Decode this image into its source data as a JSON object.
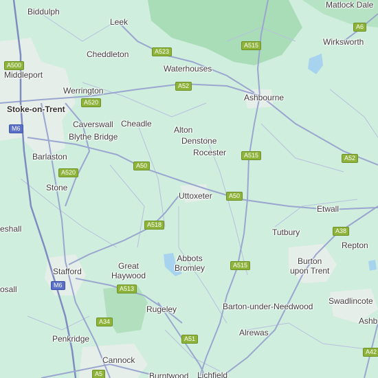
{
  "colors": {
    "land": "#cfeedd",
    "park": "#a9ddb8",
    "urban": "#e6eee9",
    "water": "#a8d3ef",
    "road": "#9aa6cf",
    "major_road_casing": "#7f8cc0",
    "a_road_shield": "#8db33a",
    "motorway_shield": "#5a6fc6"
  },
  "places": {
    "biddulph": "Biddulph",
    "leek": "Leek",
    "matlock_dale": "Matlock Dale",
    "wirksworth": "Wirksworth",
    "cheddleton": "Cheddleton",
    "waterhouses": "Waterhouses",
    "middleport": "Middleport",
    "werrington": "Werrington",
    "ashbourne": "Ashbourne",
    "stoke": "Stoke-on-Trent",
    "caverswall": "Caverswall",
    "cheadle": "Cheadle",
    "alton": "Alton",
    "blythe_bridge": "Blythe Bridge",
    "denstone": "Denstone",
    "rocester": "Rocester",
    "barlaston": "Barlaston",
    "stone": "Stone",
    "uttoxeter": "Uttoxeter",
    "etwall": "Etwall",
    "eshall": "eshall",
    "tutbury": "Tutbury",
    "repton": "Repton",
    "abbots_1": "Abbots",
    "abbots_2": "Bromley",
    "great_1": "Great",
    "great_2": "Haywood",
    "burton_1": "Burton",
    "burton_2": "upon Trent",
    "stafford": "Stafford",
    "osall": "osall",
    "swadlincote": "Swadlincote",
    "rugeley": "Rugeley",
    "barton": "Barton-under-Needwood",
    "ashb": "Ashb",
    "penkridge": "Penkridge",
    "alrewas": "Alrewas",
    "cannock": "Cannock",
    "burntwood": "Burntwood",
    "lichfield": "Lichfield"
  },
  "roads": {
    "a6": "A6",
    "a523": "A523",
    "a515_north": "A515",
    "a500": "A500",
    "a52_north": "A52",
    "a520_north": "A520",
    "m6_north": "M6",
    "a515_mid": "A515",
    "a52_east": "A52",
    "a50_west": "A50",
    "a520_south": "A520",
    "a50_east": "A50",
    "a518": "A518",
    "a38": "A38",
    "a515_south": "A515",
    "m6_south": "M6",
    "a513": "A513",
    "a34": "A34",
    "a51": "A51",
    "a42": "A42",
    "a5": "A5"
  }
}
